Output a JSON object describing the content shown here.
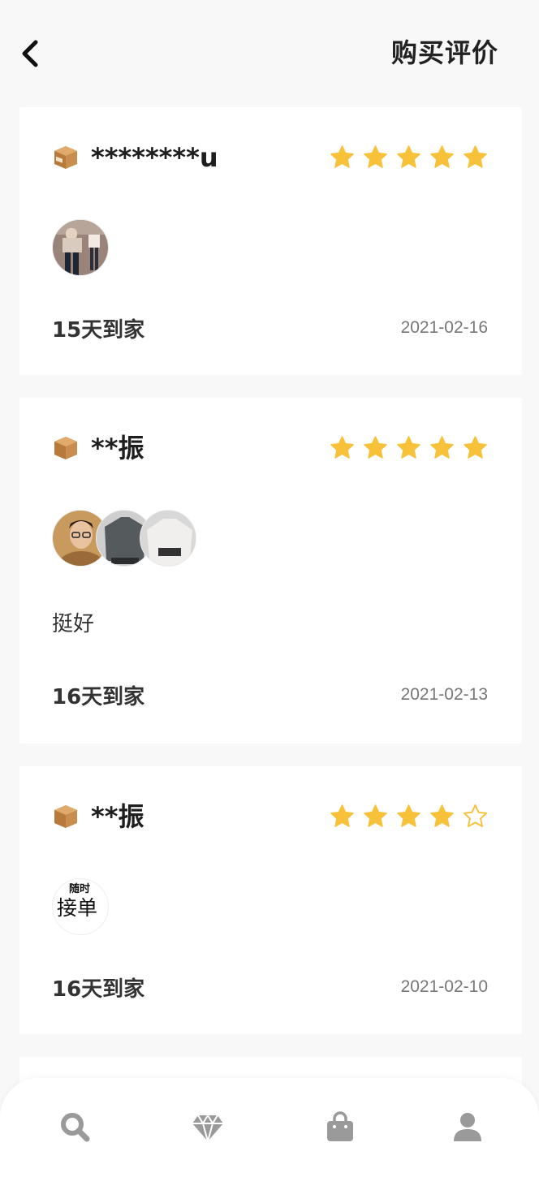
{
  "header": {
    "title": "购买评价",
    "back_icon": "chevron-left-icon"
  },
  "reviews": [
    {
      "user": "********u",
      "rating": 5,
      "photos": [
        "photo-outfit-1"
      ],
      "comment": "",
      "delivery": "15天到家",
      "date": "2021-02-16"
    },
    {
      "user": "**振",
      "rating": 5,
      "photos": [
        "photo-portrait",
        "photo-grey-sweater",
        "photo-white-sweater"
      ],
      "comment": "挺好",
      "delivery": "16天到家",
      "date": "2021-02-13"
    },
    {
      "user": "**振",
      "rating": 4,
      "photos": [
        "photo-calligraphy"
      ],
      "comment": "",
      "delivery": "16天到家",
      "date": "2021-02-10"
    }
  ],
  "photo_texts": {
    "calligraphy_small": "随时",
    "calligraphy_big": "接单"
  },
  "tabbar": {
    "items": [
      {
        "icon": "search-icon"
      },
      {
        "icon": "diamond-icon"
      },
      {
        "icon": "shopping-bag-icon"
      },
      {
        "icon": "user-icon"
      }
    ]
  },
  "colors": {
    "star": "#f8c13a",
    "star_empty_stroke": "#f8c13a",
    "tab_icon": "#9a9a9a",
    "background": "#f8f8f8"
  }
}
